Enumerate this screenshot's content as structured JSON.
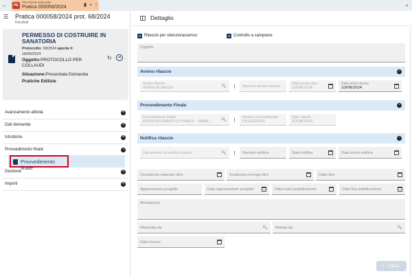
{
  "tab": {
    "app_label": "PRATICHE EDILIZIE",
    "title": "Pratica 000058/2024",
    "logo_text": "PE"
  },
  "left": {
    "header_title": "Pratica 000058/2024 prot. 68/2024",
    "header_subtitle": "Risultati",
    "card": {
      "title": "PERMESSO DI COSTRUIRE IN SANATORIA",
      "protocol_label": "Protocollo:",
      "protocol_value": "68/2024",
      "opened_label": "aperta il:",
      "opened_date": "18/06/2024",
      "subject_label": "Oggetto:",
      "subject_value": "PROTOCOLLO PER COLLAUDI",
      "status_label": "Situazione:",
      "status_value": "Presentata Domanda",
      "category": "Pratiche Edilizie"
    },
    "accordion": [
      {
        "label": "Avanzamento attività",
        "sign": "+"
      },
      {
        "label": "Dati domanda",
        "sign": "+"
      },
      {
        "label": "Istruttoria",
        "sign": "+"
      },
      {
        "label": "Provvedimento finale",
        "sign": "−"
      },
      {
        "label": "Gestione",
        "sign": "+"
      },
      {
        "label": "Importi",
        "sign": "+"
      }
    ],
    "sub_item": "Provvedimento finale"
  },
  "right": {
    "title": "Dettaglio",
    "checkbox_silenzio": "Rilascio per silenzio/assenso",
    "checkbox_controllo": "Controllo a campione",
    "oggetto_label": "Oggetto",
    "sec_avviso": "Avviso rilascio",
    "avviso": {
      "label": "Avviso rilascio",
      "value": "Avviso di rilascio",
      "numero_placeholder": "Numero avviso rilascio",
      "data_label": "Data avviso rilas...",
      "data_value": "20/06/2024",
      "arrivo_label": "Data arrivo avviso",
      "arrivo_value": "10/06/2024"
    },
    "sec_provv": "Provvedimento Finale",
    "provv": {
      "label": "Provvedimento Finale",
      "value": "PROVVEDIMENTO FINALE - Mode...",
      "numero_label": "Numero provvedimento",
      "numero_value": "PE110/2024",
      "data_label": "Data rilascio",
      "data_value": "20/06/2024"
    },
    "sec_notifica": "Notifica rilascio",
    "notifica": {
      "doc_placeholder": "Documento di notifica rilascio",
      "numero_placeholder": "Numero notifica",
      "data_placeholder": "Data notifica",
      "arrivo_placeholder": "Data arrivo notifica"
    },
    "decadenza": "Decadenza mancato ritiro",
    "scadenza_proroga": "Scadenza proroga ritiro",
    "data_ritiro": "Data ritiro",
    "approvazione_progetto": "Approvazione progetto",
    "data_approvazione": "Data approvazione progetto",
    "data_inizio_pubbl": "Data inizio pubblicazione",
    "data_fine_pubbl": "Data fine pubblicazione",
    "annotazioni": "Annotazioni",
    "rilasciata_da": "Rilasciata da",
    "ritirata_da": "Ritirata da",
    "data_revoca": "Data revoca",
    "save_label": "Salva"
  }
}
